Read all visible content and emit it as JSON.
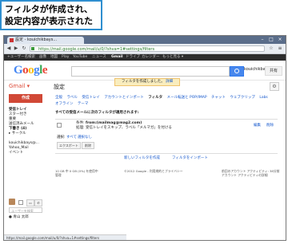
{
  "callout": {
    "line1": "フィルタが作成され、",
    "line2": "設定内容が表示された"
  },
  "browser": {
    "tab_title": "設定 - kouichikbays...",
    "url": "https://mail.google.com/mail/u/0/?shva=1#settings/filters",
    "status_url": "https://mail.google.com/mail/u/0/?shva=1#settings/filters"
  },
  "gbar": [
    "+ユーザー名",
    "検索",
    "画像",
    "地図",
    "Play",
    "YouTube",
    "ニュース",
    "Gmail",
    "ドライブ",
    "カレンダー",
    "もっと見る ▾"
  ],
  "header": {
    "logo": "Google",
    "user": "kouichikbays@...",
    "share": "共有"
  },
  "gmail_label": "Gmail ▾",
  "settings_title": "設定",
  "notification": {
    "text": "フィルタを作成しました。",
    "link": "詳細"
  },
  "compose_label": "作成",
  "sidebar": {
    "items": [
      "受信トレイ",
      "スター付き",
      "重要",
      "送信済みメール",
      "下書き (4)",
      "▸ サークル",
      "kouichikbays@...",
      "Yahoo_Mail",
      "イベント"
    ],
    "search_placeholder": "ユーザーを検索",
    "contact": "● 青山 太郎"
  },
  "settings_tabs": {
    "row1": [
      "全般",
      "ラベル",
      "受信トレイ",
      "アカウントとインポート",
      "フィルタ",
      "メール転送と POP/IMAP",
      "チャット",
      "ウェブクリップ",
      "Labs"
    ],
    "row2": [
      "オフライン",
      "テーマ"
    ],
    "active": "フィルタ"
  },
  "filters": {
    "heading": "すべての受信メールに次のフィルタが適用されます:",
    "condition_label": "条件:",
    "condition_value": "from:(mailmag@mag2.com)",
    "action_label": "処理:",
    "action_value": "受信トレイをスキップ、ラベル「メルマガ」を付ける",
    "edit": "編集",
    "delete": "削除",
    "select_label": "選択:",
    "select_all": "すべて",
    "select_none": "選択なし",
    "export_button": "エクスポート",
    "delete_button": "削除",
    "new_filter": "新しいフィルタを作成",
    "import_filter": "フィルタをインポート"
  },
  "footer": {
    "usage": "10 GB 中 0 GB (0%) を使用中",
    "manage": "管理",
    "copyright": "©2012 Google - 利用規約とプライバシー",
    "last_activity": "前回のアカウント アクティビティ: 38分前",
    "details": "アカウント アクティビティの詳細"
  }
}
